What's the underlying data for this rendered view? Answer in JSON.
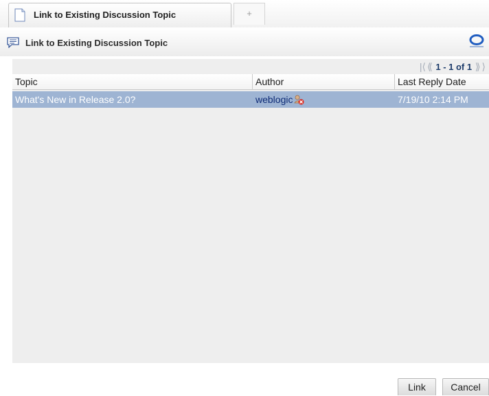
{
  "tab": {
    "active_label": "Link to Existing Discussion Topic",
    "new_tab_symbol": "+"
  },
  "header": {
    "title": "Link to Existing Discussion Topic"
  },
  "pager": {
    "range": "1 - 1 of 1"
  },
  "table": {
    "columns": [
      "Topic",
      "Author",
      "Last Reply Date"
    ],
    "rows": [
      {
        "topic": "What's New in Release 2.0?",
        "author": "weblogic",
        "last_reply": "7/19/10 2:14 PM",
        "selected": true
      }
    ]
  },
  "buttons": {
    "link": "Link",
    "cancel": "Cancel"
  },
  "icons": [
    "document-icon",
    "discussion-icon",
    "oracle-logo-icon",
    "first-page-icon",
    "prev-page-icon",
    "next-page-icon",
    "last-page-icon",
    "presence-offline-icon"
  ],
  "colors": {
    "selected_row": "#9eb4d3",
    "author_link": "#0e2b76",
    "panel_bg": "#eeeeee"
  }
}
